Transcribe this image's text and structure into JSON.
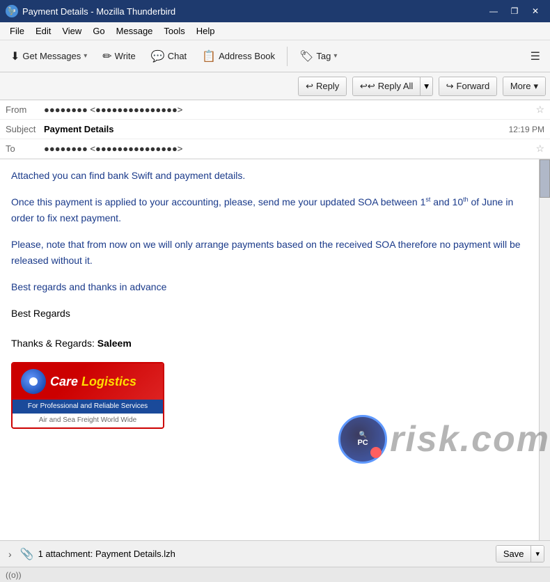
{
  "window": {
    "title": "Payment Details - Mozilla Thunderbird",
    "icon": "🦅"
  },
  "title_controls": {
    "minimize": "—",
    "maximize": "❐",
    "close": "✕"
  },
  "menu": {
    "items": [
      "File",
      "Edit",
      "View",
      "Go",
      "Message",
      "Tools",
      "Help"
    ]
  },
  "toolbar": {
    "get_messages": "Get Messages",
    "write": "Write",
    "chat": "Chat",
    "address_book": "Address Book",
    "tag": "Tag",
    "tag_arrow": "▾",
    "hamburger": "☰"
  },
  "action_bar": {
    "reply": "Reply",
    "reply_all": "Reply All",
    "forward": "Forward",
    "more": "More"
  },
  "email_header": {
    "from_label": "From",
    "from_value": "●●●●●●●● <●●●●●●●●●●●●●●●>",
    "from_star": "☆",
    "subject_label": "Subject",
    "subject_value": "Payment Details",
    "time": "12:19 PM",
    "to_label": "To",
    "to_value": "●●●●●●●● <●●●●●●●●●●●●●●●>"
  },
  "email_body": {
    "para1": "Attached you can find bank Swift and payment details.",
    "para2_start": "Once this payment is applied to your accounting, please, send me your updated SOA between 1",
    "para2_1st": "st",
    "para2_mid": " and 10",
    "para2_th": "th",
    "para2_end": " of June in order to fix next payment.",
    "para3": "Please, note that from now on we will only arrange payments based on the received SOA therefore no payment will be released without it.",
    "para4": "Best regards and thanks in advance",
    "para5": "Best Regards",
    "para6_prefix": "Thanks & Regards: ",
    "para6_name": "Saleem"
  },
  "logo": {
    "care": "Care",
    "logistics": " Logistics",
    "tagline": "For Professional and Reliable Services",
    "sub": "Air and Sea Freight World Wide"
  },
  "status_bar": {
    "expand_icon": "›",
    "attach_icon": "📎",
    "attachment_label": "1 attachment: Payment Details.lzh",
    "save": "Save",
    "save_arrow": "▾"
  },
  "bottom_status": {
    "icon": "((o))",
    "text": ""
  }
}
